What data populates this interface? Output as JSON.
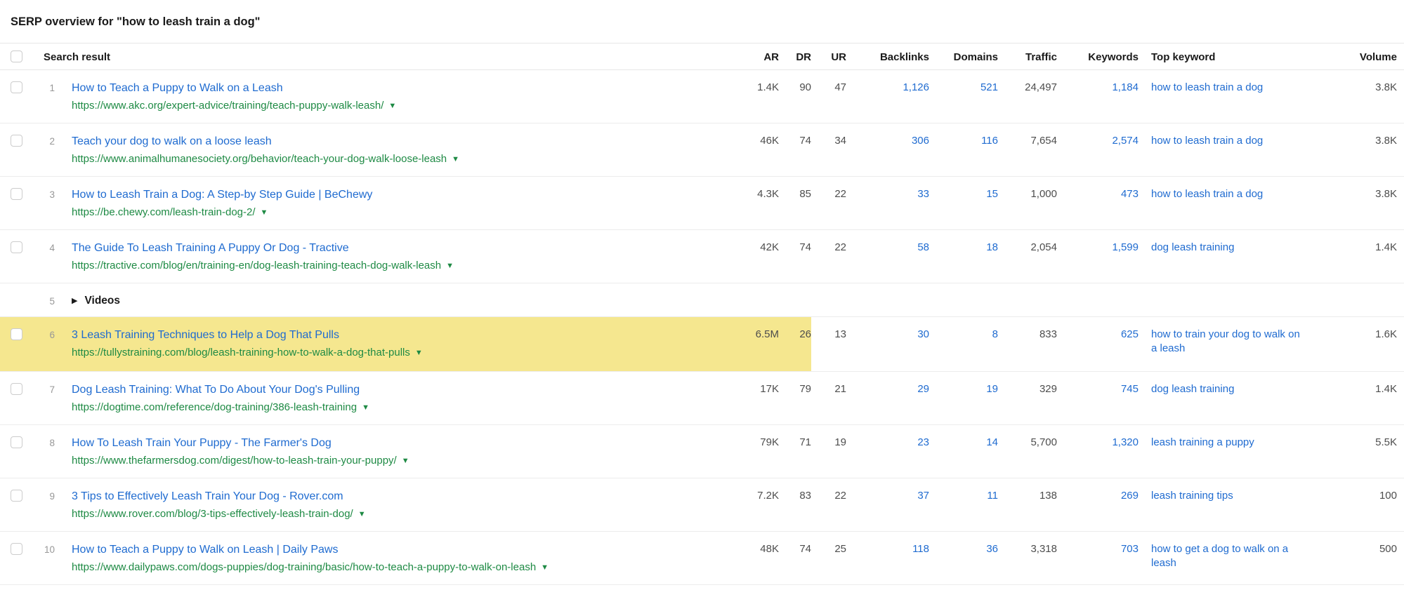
{
  "page_title": "SERP overview for \"how to leash train a dog\"",
  "colors": {
    "link_blue": "#1f6bd0",
    "url_green": "#1e8a44",
    "highlight_yellow": "#f5e78f",
    "metric_gray": "#4d4d4d"
  },
  "table": {
    "columns": {
      "search_result": "Search result",
      "ar": "AR",
      "dr": "DR",
      "ur": "UR",
      "backlinks": "Backlinks",
      "domains": "Domains",
      "traffic": "Traffic",
      "keywords": "Keywords",
      "top_keyword": "Top keyword",
      "volume": "Volume"
    },
    "rows": [
      {
        "type": "result",
        "rank": "1",
        "highlighted": false,
        "title": "How to Teach a Puppy to Walk on a Leash",
        "url": "https://www.akc.org/expert-advice/training/teach-puppy-walk-leash/",
        "ar": "1.4K",
        "dr": "90",
        "ur": "47",
        "backlinks": "1,126",
        "domains": "521",
        "traffic": "24,497",
        "keywords": "1,184",
        "top_keyword": "how to leash train a dog",
        "volume": "3.8K"
      },
      {
        "type": "result",
        "rank": "2",
        "highlighted": false,
        "title": "Teach your dog to walk on a loose leash",
        "url": "https://www.animalhumanesociety.org/behavior/teach-your-dog-walk-loose-leash",
        "ar": "46K",
        "dr": "74",
        "ur": "34",
        "backlinks": "306",
        "domains": "116",
        "traffic": "7,654",
        "keywords": "2,574",
        "top_keyword": "how to leash train a dog",
        "volume": "3.8K"
      },
      {
        "type": "result",
        "rank": "3",
        "highlighted": false,
        "title": "How to Leash Train a Dog: A Step-by Step Guide | BeChewy",
        "url": "https://be.chewy.com/leash-train-dog-2/",
        "ar": "4.3K",
        "dr": "85",
        "ur": "22",
        "backlinks": "33",
        "domains": "15",
        "traffic": "1,000",
        "keywords": "473",
        "top_keyword": "how to leash train a dog",
        "volume": "3.8K"
      },
      {
        "type": "result",
        "rank": "4",
        "highlighted": false,
        "title": "The Guide To Leash Training A Puppy Or Dog - Tractive",
        "url": "https://tractive.com/blog/en/training-en/dog-leash-training-teach-dog-walk-leash",
        "ar": "42K",
        "dr": "74",
        "ur": "22",
        "backlinks": "58",
        "domains": "18",
        "traffic": "2,054",
        "keywords": "1,599",
        "top_keyword": "dog leash training",
        "volume": "1.4K"
      },
      {
        "type": "group",
        "rank": "5",
        "label": "Videos"
      },
      {
        "type": "result",
        "rank": "6",
        "highlighted": true,
        "title": "3 Leash Training Techniques to Help a Dog That Pulls",
        "url": "https://tullystraining.com/blog/leash-training-how-to-walk-a-dog-that-pulls",
        "ar": "6.5M",
        "dr": "26",
        "ur": "13",
        "backlinks": "30",
        "domains": "8",
        "traffic": "833",
        "keywords": "625",
        "top_keyword": "how to train your dog to walk on a leash",
        "volume": "1.6K"
      },
      {
        "type": "result",
        "rank": "7",
        "highlighted": false,
        "title": "Dog Leash Training: What To Do About Your Dog's Pulling",
        "url": "https://dogtime.com/reference/dog-training/386-leash-training",
        "ar": "17K",
        "dr": "79",
        "ur": "21",
        "backlinks": "29",
        "domains": "19",
        "traffic": "329",
        "keywords": "745",
        "top_keyword": "dog leash training",
        "volume": "1.4K"
      },
      {
        "type": "result",
        "rank": "8",
        "highlighted": false,
        "title": "How To Leash Train Your Puppy - The Farmer's Dog",
        "url": "https://www.thefarmersdog.com/digest/how-to-leash-train-your-puppy/",
        "ar": "79K",
        "dr": "71",
        "ur": "19",
        "backlinks": "23",
        "domains": "14",
        "traffic": "5,700",
        "keywords": "1,320",
        "top_keyword": "leash training a puppy",
        "volume": "5.5K"
      },
      {
        "type": "result",
        "rank": "9",
        "highlighted": false,
        "title": "3 Tips to Effectively Leash Train Your Dog - Rover.com",
        "url": "https://www.rover.com/blog/3-tips-effectively-leash-train-dog/",
        "ar": "7.2K",
        "dr": "83",
        "ur": "22",
        "backlinks": "37",
        "domains": "11",
        "traffic": "138",
        "keywords": "269",
        "top_keyword": "leash training tips",
        "volume": "100"
      },
      {
        "type": "result",
        "rank": "10",
        "highlighted": false,
        "title": "How to Teach a Puppy to Walk on Leash | Daily Paws",
        "url": "https://www.dailypaws.com/dogs-puppies/dog-training/basic/how-to-teach-a-puppy-to-walk-on-leash",
        "ar": "48K",
        "dr": "74",
        "ur": "25",
        "backlinks": "118",
        "domains": "36",
        "traffic": "3,318",
        "keywords": "703",
        "top_keyword": "how to get a dog to walk on a leash",
        "volume": "500"
      }
    ]
  }
}
